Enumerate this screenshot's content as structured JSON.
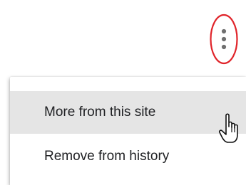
{
  "colors": {
    "highlight_ellipse": "#e0242a",
    "kebab_dots": "#6f6f6f",
    "hovered_item_bg": "#e5e5e5",
    "menu_text": "#202124"
  },
  "header": {
    "more_button_icon": "vertical-ellipsis-icon"
  },
  "menu": {
    "items": [
      {
        "label": "More from this site",
        "state": "hovered"
      },
      {
        "label": "Remove from history",
        "state": "normal"
      }
    ]
  },
  "cursor": {
    "icon": "hand-pointer-icon"
  }
}
